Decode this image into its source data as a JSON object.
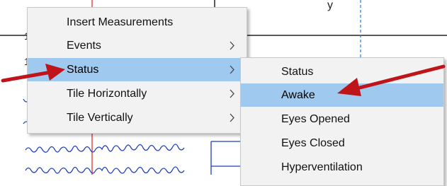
{
  "context_menu": {
    "items": [
      {
        "label": "Insert Measurements",
        "has_submenu": false,
        "highlighted": false
      },
      {
        "label": "Events",
        "has_submenu": true,
        "highlighted": false
      },
      {
        "label": "Status",
        "has_submenu": true,
        "highlighted": true
      },
      {
        "label": "Tile Horizontally",
        "has_submenu": true,
        "highlighted": false
      },
      {
        "label": "Tile Vertically",
        "has_submenu": true,
        "highlighted": false
      }
    ]
  },
  "status_submenu": {
    "items": [
      {
        "label": "Status",
        "highlighted": false
      },
      {
        "label": "Awake",
        "highlighted": true
      },
      {
        "label": "Eyes Opened",
        "highlighted": false
      },
      {
        "label": "Eyes Closed",
        "highlighted": false
      },
      {
        "label": "Hyperventilation",
        "highlighted": false
      }
    ]
  },
  "colors": {
    "highlight": "#9fc9ef",
    "annotation_arrow": "#c0141b",
    "eeg_trace": "#1f3fbf",
    "cursor_line": "#e02020",
    "marker_line": "#1e7fe0"
  },
  "icons": {
    "submenu_indicator": "chevron-right-icon",
    "annotation": "red-arrow-icon"
  }
}
